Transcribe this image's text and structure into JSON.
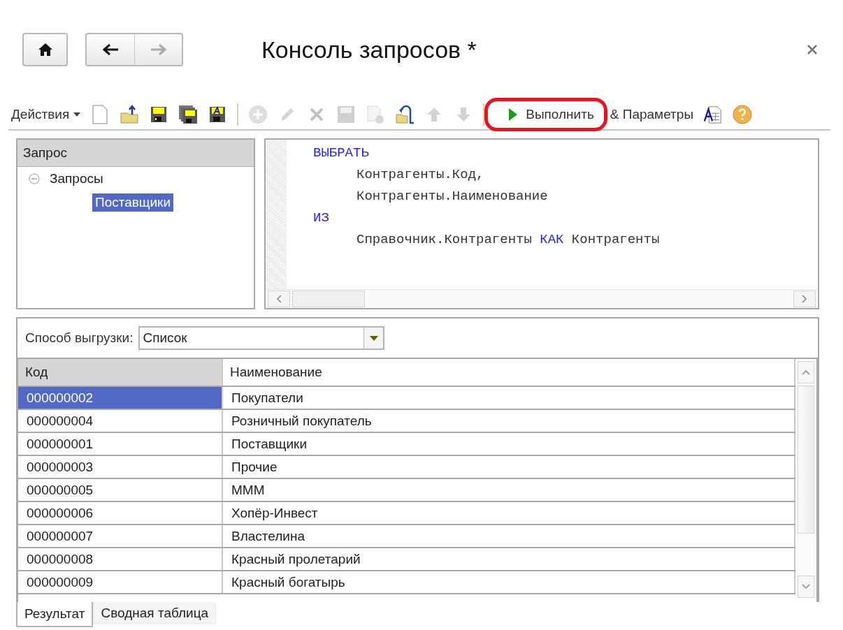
{
  "window": {
    "title": "Консоль запросов *"
  },
  "toolbar": [
    {
      "kind": "menu",
      "label": "Действия"
    },
    {
      "kind": "icon",
      "disabled": false
    },
    {
      "kind": "icon",
      "disabled": false
    },
    {
      "kind": "icon",
      "disabled": false
    },
    {
      "kind": "icon",
      "disabled": false
    },
    {
      "kind": "icon",
      "disabled": false
    },
    {
      "kind": "separator"
    },
    {
      "kind": "icon",
      "disabled": true
    },
    {
      "kind": "icon",
      "disabled": true
    },
    {
      "kind": "icon",
      "disabled": true
    },
    {
      "kind": "icon",
      "disabled": true
    },
    {
      "kind": "icon",
      "disabled": true
    },
    {
      "kind": "icon",
      "disabled": false
    },
    {
      "kind": "icon",
      "disabled": true
    },
    {
      "kind": "icon",
      "disabled": true
    },
    {
      "kind": "separator"
    },
    {
      "kind": "run",
      "label": "Выполнить",
      "highlighted": true
    },
    {
      "kind": "text",
      "label": "& Параметры"
    },
    {
      "kind": "icon",
      "disabled": false
    },
    {
      "kind": "icon",
      "disabled": false
    }
  ],
  "query_tree": {
    "header": "Запрос",
    "items": [
      {
        "label": "Запросы",
        "expanded": true,
        "selected": false,
        "children": [
          {
            "label": "Поставщики",
            "selected": true
          }
        ]
      }
    ]
  },
  "editor": {
    "lines": [
      {
        "indented": false,
        "segments": [
          {
            "kind": "keyword",
            "text": "ВЫБРАТЬ"
          }
        ]
      },
      {
        "indented": true,
        "segments": [
          {
            "kind": "plain",
            "text": "Контрагенты.Код,"
          }
        ]
      },
      {
        "indented": true,
        "segments": [
          {
            "kind": "plain",
            "text": "Контрагенты.Наименование"
          }
        ]
      },
      {
        "indented": false,
        "segments": [
          {
            "kind": "keyword",
            "text": "ИЗ"
          }
        ]
      },
      {
        "indented": true,
        "segments": [
          {
            "kind": "plain",
            "text": "Справочник.Контрагенты "
          },
          {
            "kind": "keyword",
            "text": "КАК"
          },
          {
            "kind": "plain",
            "text": " Контрагенты"
          }
        ]
      }
    ]
  },
  "export_mode": {
    "label": "Способ выгрузки:",
    "value": "Список"
  },
  "table": {
    "columns": [
      "Код",
      "Наименование"
    ],
    "rows": [
      {
        "code": "000000002",
        "name": "Покупатели",
        "selected": true
      },
      {
        "code": "000000004",
        "name": "Розничный покупатель",
        "selected": false
      },
      {
        "code": "000000001",
        "name": "Поставщики",
        "selected": false
      },
      {
        "code": "000000003",
        "name": "Прочие",
        "selected": false
      },
      {
        "code": "000000005",
        "name": "МММ",
        "selected": false
      },
      {
        "code": "000000006",
        "name": "Хопёр-Инвест",
        "selected": false
      },
      {
        "code": "000000007",
        "name": "Властелина",
        "selected": false
      },
      {
        "code": "000000008",
        "name": "Красный пролетарий",
        "selected": false
      },
      {
        "code": "000000009",
        "name": "Красный богатырь",
        "selected": false
      }
    ]
  },
  "tabs": [
    {
      "label": "Результат",
      "selected": true
    },
    {
      "label": "Сводная таблица",
      "selected": false
    }
  ]
}
